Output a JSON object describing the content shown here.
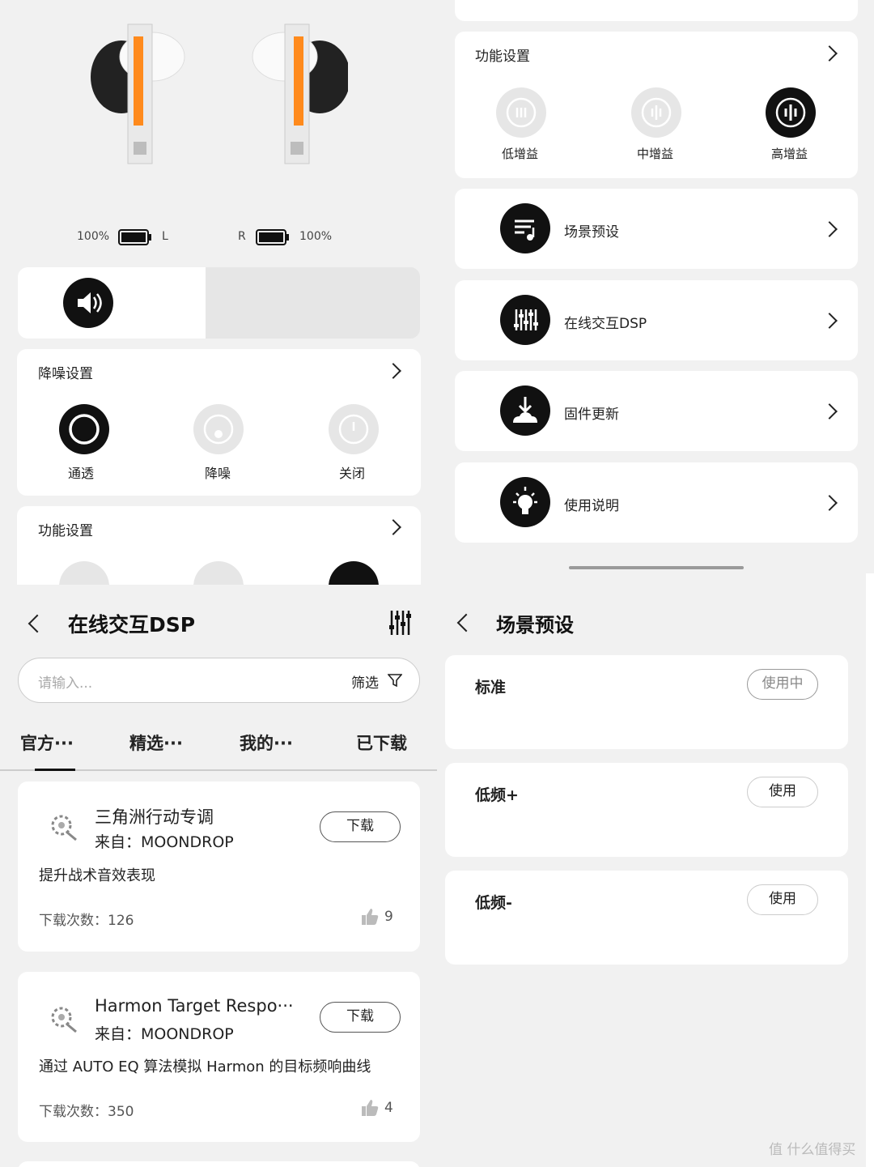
{
  "earbuds": {
    "left": {
      "battery": "100%",
      "side": "L"
    },
    "right": {
      "battery": "100%",
      "side": "R"
    }
  },
  "noise": {
    "title": "降噪设置",
    "options": [
      {
        "label": "通透",
        "active": true
      },
      {
        "label": "降噪",
        "active": false
      },
      {
        "label": "关闭",
        "active": false
      }
    ]
  },
  "function": {
    "title": "功能设置",
    "options": [
      {
        "label": "低增益",
        "active": false
      },
      {
        "label": "中增益",
        "active": false
      },
      {
        "label": "高增益",
        "active": true
      }
    ]
  },
  "menu": [
    {
      "label": "场景预设",
      "icon": "music-list-icon"
    },
    {
      "label": "在线交互DSP",
      "icon": "equalizer-icon"
    },
    {
      "label": "固件更新",
      "icon": "cloud-download-icon"
    },
    {
      "label": "使用说明",
      "icon": "lightbulb-icon"
    }
  ],
  "dsp": {
    "title": "在线交互DSP",
    "search_placeholder": "请输入...",
    "filter_label": "筛选",
    "tabs": [
      "官方···",
      "精选···",
      "我的···",
      "已下载"
    ],
    "items": [
      {
        "name": "三角洲行动专调",
        "source": "来自：MOONDROP",
        "desc": "提升战术音效表现",
        "downloads": "下载次数：126",
        "likes": "9",
        "button": "下载"
      },
      {
        "name": "Harmon Target Respo···",
        "source": "来自：MOONDROP",
        "desc": "通过 AUTO EQ 算法模拟 Harmon 的目标频响曲线",
        "downloads": "下载次数：350",
        "likes": "4",
        "button": "下载"
      }
    ]
  },
  "scene": {
    "title": "场景预设",
    "items": [
      {
        "name": "标准",
        "button": "使用中",
        "active": true
      },
      {
        "name": "低频+",
        "button": "使用",
        "active": false
      },
      {
        "name": "低频-",
        "button": "使用",
        "active": false
      }
    ]
  },
  "watermark": "值 什么值得买"
}
